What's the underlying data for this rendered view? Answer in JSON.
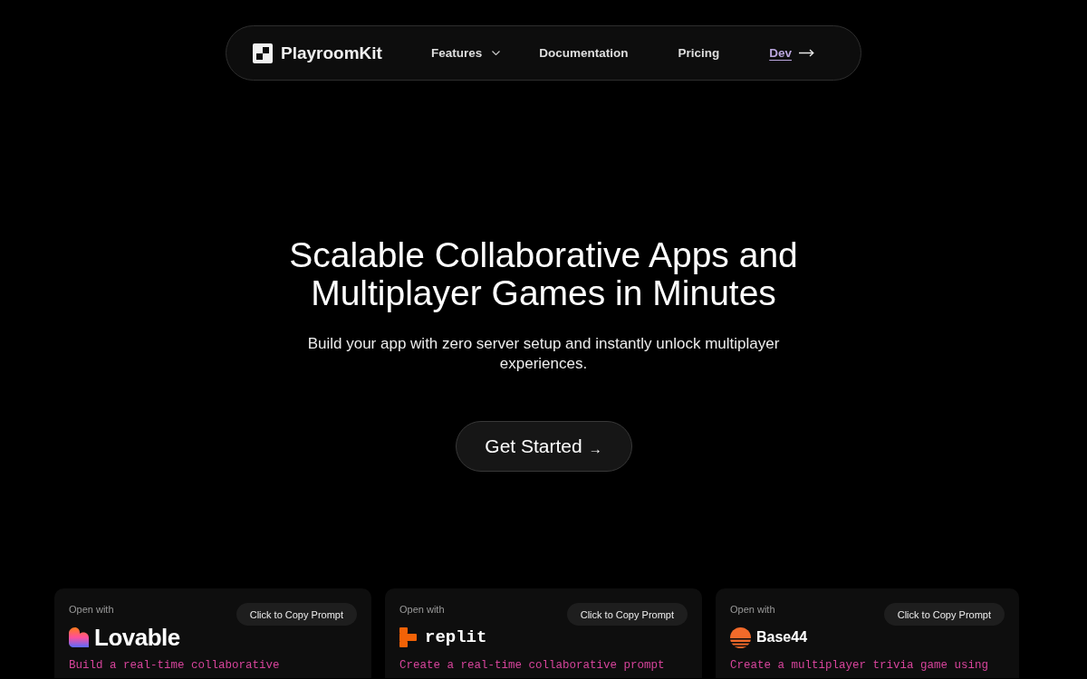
{
  "nav": {
    "brand": "PlayroomKit",
    "items": [
      {
        "label": "Features",
        "kind": "dropdown"
      },
      {
        "label": "Documentation",
        "kind": "link"
      },
      {
        "label": "Pricing",
        "kind": "link"
      },
      {
        "label": "Dev",
        "kind": "arrow-link"
      }
    ]
  },
  "hero": {
    "title": "Scalable Collaborative Apps and Multiplayer Games in Minutes",
    "subtitle": "Build your app with zero server setup and instantly unlock multiplayer experiences.",
    "cta": {
      "label": "Get Started",
      "arrow": "→"
    }
  },
  "cards": [
    {
      "caption": "Open with",
      "kind": "heart",
      "brand": "Lovable",
      "copy_button": "Click to Copy Prompt",
      "prompt": "Build a real-time collaborative"
    },
    {
      "caption": "Open with",
      "kind": "blocks",
      "brand": "replit",
      "copy_button": "Click to Copy Prompt",
      "prompt": "Create a real-time collaborative prompt"
    },
    {
      "caption": "Open with",
      "kind": "striped",
      "brand": "Base44",
      "copy_button": "Click to Copy Prompt",
      "prompt": "Create a multiplayer trivia game using"
    }
  ]
}
